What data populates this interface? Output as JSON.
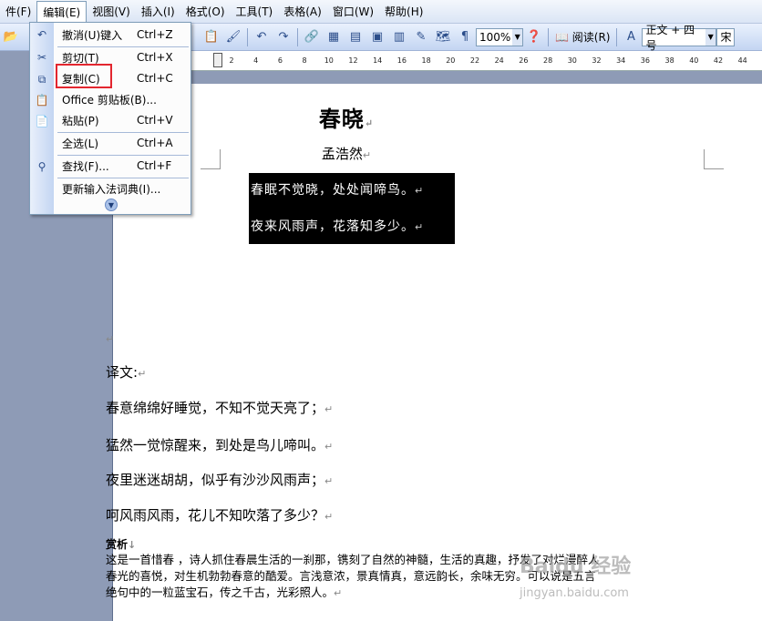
{
  "menubar": {
    "items": [
      "件(F)",
      "编辑(E)",
      "视图(V)",
      "插入(I)",
      "格式(O)",
      "工具(T)",
      "表格(A)",
      "窗口(W)",
      "帮助(H)"
    ]
  },
  "toolbar": {
    "zoom": "100%",
    "read_label": "阅读(R)",
    "style_value": "正文 + 四号",
    "font_value": "宋"
  },
  "ruler": {
    "ticks": [
      "2",
      "2",
      "4",
      "6",
      "8",
      "10",
      "12",
      "14",
      "16",
      "18",
      "20",
      "22",
      "24",
      "26",
      "28",
      "30",
      "32",
      "34",
      "36",
      "38",
      "40",
      "42",
      "44"
    ]
  },
  "edit_menu": {
    "items": [
      {
        "label": "撤消(U)键入",
        "shortcut": "Ctrl+Z",
        "icon": "undo-icon"
      },
      {
        "label": "剪切(T)",
        "shortcut": "Ctrl+X",
        "icon": "scissors-icon"
      },
      {
        "label": "复制(C)",
        "shortcut": "Ctrl+C",
        "icon": "copy-icon"
      },
      {
        "label": "Office 剪贴板(B)...",
        "shortcut": "",
        "icon": "clipboard-icon"
      },
      {
        "label": "粘贴(P)",
        "shortcut": "Ctrl+V",
        "icon": "paste-icon"
      },
      {
        "label": "全选(L)",
        "shortcut": "Ctrl+A",
        "icon": ""
      },
      {
        "label": "查找(F)...",
        "shortcut": "Ctrl+F",
        "icon": "binoculars-icon"
      },
      {
        "label": "更新输入法词典(I)...",
        "shortcut": "",
        "icon": ""
      }
    ]
  },
  "document": {
    "title": "春晓",
    "author": "孟浩然",
    "selected_lines": [
      "春眠不觉晓，处处闻啼鸟。",
      "夜来风雨声，花落知多少。"
    ],
    "translation_label": "译文:",
    "translation_lines": [
      "春意绵绵好睡觉，不知不觉天亮了；",
      "猛然一觉惊醒来，到处是鸟儿啼叫。",
      "夜里迷迷胡胡，似乎有沙沙风雨声；",
      "呵风雨风雨，花儿不知吹落了多少？"
    ],
    "analysis_label": "赏析",
    "analysis_text": "这是一首惜春 ，诗人抓住春晨生活的一刹那，镌刻了自然的神髓，生活的真趣，抒发了对烂漫醉人春光的喜悦，对生机勃勃春意的酷爱。言浅意浓，景真情真，意远韵长，余味无穷。可以说是五言绝句中的一粒蓝宝石，传之千古，光彩照人。"
  },
  "watermark": {
    "text": "Baidu 经验",
    "url": "jingyan.baidu.com"
  }
}
